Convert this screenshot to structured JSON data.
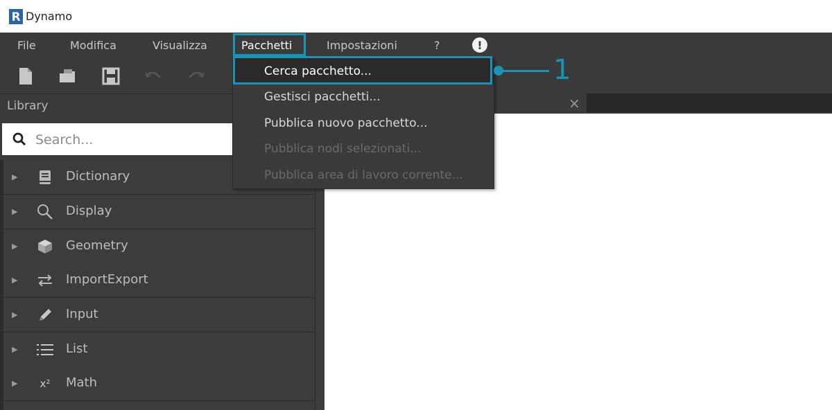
{
  "window": {
    "title": "Dynamo",
    "logo_letter": "R"
  },
  "menubar": {
    "items": [
      {
        "label": "File"
      },
      {
        "label": "Modifica"
      },
      {
        "label": "Visualizza"
      },
      {
        "label": "Pacchetti"
      },
      {
        "label": "Impostazioni"
      },
      {
        "label": "?"
      },
      {
        "label": "!"
      }
    ]
  },
  "toolbar": {
    "icons": [
      "new-file-icon",
      "open-folder-icon",
      "save-icon",
      "undo-icon",
      "redo-icon"
    ]
  },
  "library": {
    "title": "Library",
    "search_placeholder": "Search...",
    "items": [
      {
        "label": "Dictionary",
        "icon": "book-icon"
      },
      {
        "label": "Display",
        "icon": "magnifier-icon"
      },
      {
        "label": "Geometry",
        "icon": "cube-icon"
      },
      {
        "label": "ImportExport",
        "icon": "swap-arrows-icon"
      },
      {
        "label": "Input",
        "icon": "pencil-icon"
      },
      {
        "label": "List",
        "icon": "list-icon"
      },
      {
        "label": "Math",
        "icon": "x-squared-icon",
        "icon_text": "x²"
      }
    ]
  },
  "dropdown": {
    "items": [
      {
        "label": "Cerca pacchetto...",
        "enabled": true,
        "highlighted": true
      },
      {
        "label": "Gestisci pacchetti...",
        "enabled": true
      },
      {
        "label": "Pubblica nuovo pacchetto...",
        "enabled": true
      },
      {
        "label": "Pubblica nodi selezionati...",
        "enabled": false
      },
      {
        "label": "Pubblica area di lavoro corrente...",
        "enabled": false
      }
    ]
  },
  "tab": {
    "close_glyph": "×"
  },
  "callout": {
    "number": "1"
  },
  "colors": {
    "accent": "#1794b8",
    "panel": "#3a3a3a",
    "dark": "#2b2b2b"
  }
}
